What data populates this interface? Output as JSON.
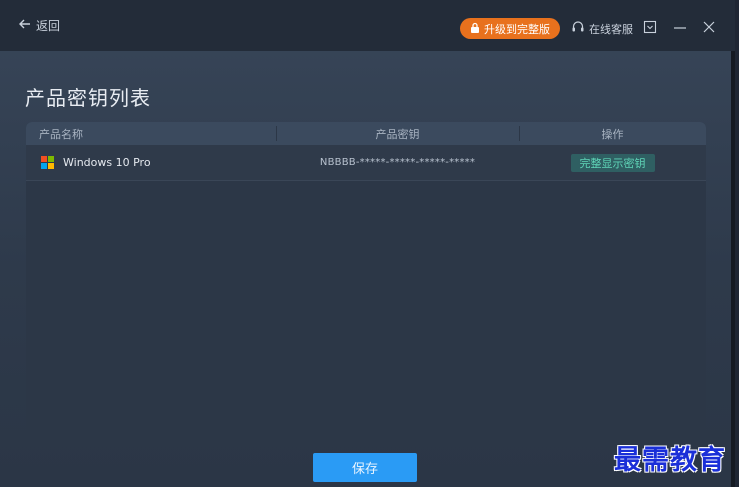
{
  "titlebar": {
    "back_label": "返回",
    "upgrade_label": "升级到完整版",
    "support_label": "在线客服"
  },
  "page": {
    "title": "产品密钥列表"
  },
  "table": {
    "headers": [
      "产品名称",
      "产品密钥",
      "操作"
    ],
    "rows": [
      {
        "product": "Windows 10 Pro",
        "key": "NBBBB-*****-*****-*****-*****",
        "action": "完整显示密钥"
      }
    ]
  },
  "footer": {
    "save_label": "保存"
  },
  "watermark": "最需教育",
  "colors": {
    "upgrade": "#e8711d",
    "save": "#2a9bf5",
    "action_text": "#5fd6b8",
    "titlebar": "#232c39"
  }
}
